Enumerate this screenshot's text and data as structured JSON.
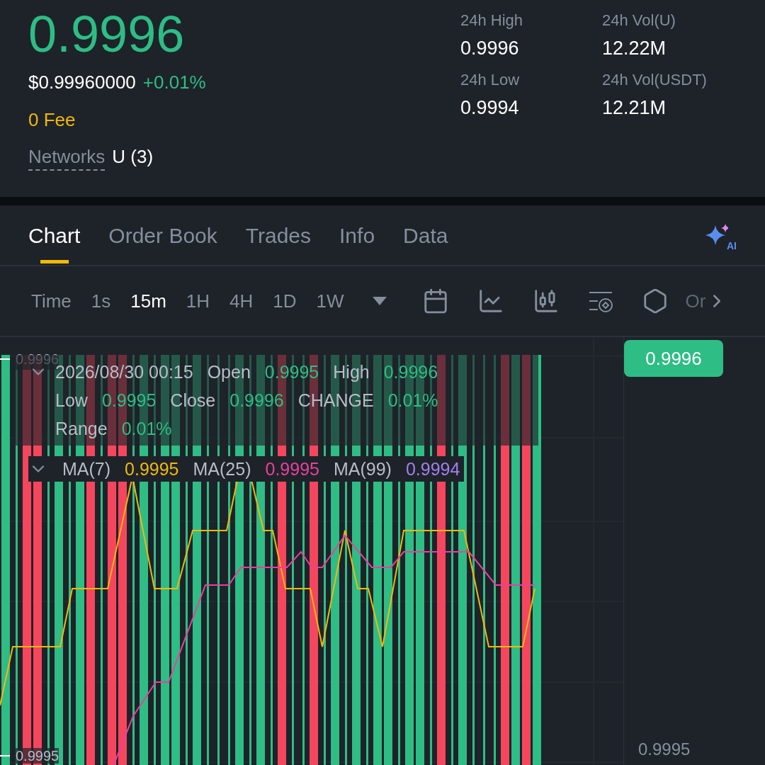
{
  "header": {
    "price": "0.9996",
    "usd_price": "$0.99960000",
    "change": "+0.01%",
    "fee": "0 Fee",
    "networks_label": "Networks",
    "networks_value": "U (3)"
  },
  "stats": [
    {
      "label": "24h High",
      "value": "0.9996"
    },
    {
      "label": "24h Vol(U)",
      "value": "12.22M"
    },
    {
      "label": "24h Low",
      "value": "0.9994"
    },
    {
      "label": "24h Vol(USDT)",
      "value": "12.21M"
    }
  ],
  "tabs": [
    {
      "label": "Chart",
      "selected": true
    },
    {
      "label": "Order Book",
      "selected": false
    },
    {
      "label": "Trades",
      "selected": false
    },
    {
      "label": "Info",
      "selected": false
    },
    {
      "label": "Data",
      "selected": false
    }
  ],
  "ai_label": "AI",
  "intervals": [
    {
      "label": "Time",
      "selected": false
    },
    {
      "label": "1s",
      "selected": false
    },
    {
      "label": "15m",
      "selected": true
    },
    {
      "label": "1H",
      "selected": false
    },
    {
      "label": "4H",
      "selected": false
    },
    {
      "label": "1D",
      "selected": false
    },
    {
      "label": "1W",
      "selected": false
    }
  ],
  "more_label": "Or",
  "chart": {
    "top_tick": "0.9996",
    "bottom_tick": "0.9995",
    "axis_tick": "0.9995",
    "last_price": "0.9996",
    "legend": {
      "date": "2026/08/30 00:15",
      "fields": [
        {
          "label": "Open",
          "value": "0.9995"
        },
        {
          "label": "High",
          "value": "0.9996"
        },
        {
          "label": "Low",
          "value": "0.9995"
        },
        {
          "label": "Close",
          "value": "0.9996"
        },
        {
          "label": "CHANGE",
          "value": "0.01%"
        },
        {
          "label": "Range",
          "value": "0.01%"
        }
      ]
    },
    "ma": [
      {
        "label": "MA(7)",
        "value": "0.9995",
        "color": "#f0b90b"
      },
      {
        "label": "MA(25)",
        "value": "0.9995",
        "color": "#e8409f"
      },
      {
        "label": "MA(99)",
        "value": "0.9994",
        "color": "#a37ff0"
      }
    ]
  }
}
